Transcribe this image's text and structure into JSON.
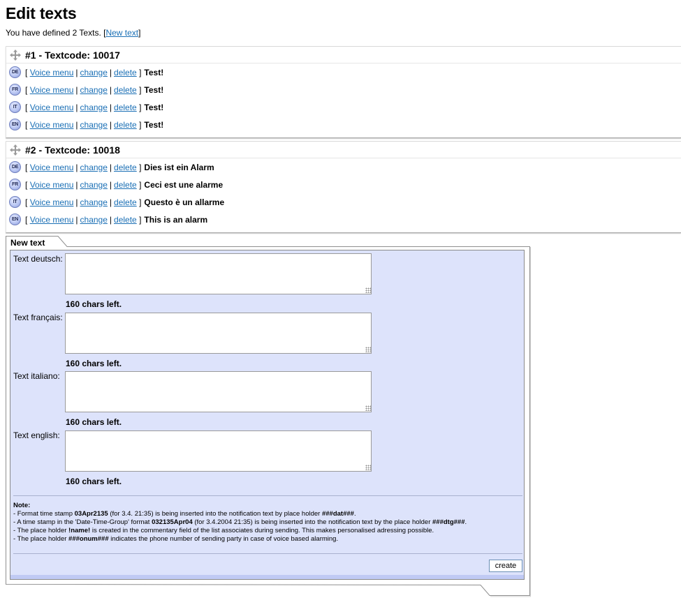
{
  "page": {
    "title": "Edit texts",
    "intro_prefix": "You have defined 2 Texts. [",
    "new_text_link": "New text",
    "intro_suffix": "]"
  },
  "row_links": {
    "open": "[",
    "voice_menu": "Voice menu",
    "pipe": "|",
    "change": "change",
    "delete": "delete",
    "close": "]"
  },
  "texts": [
    {
      "title": "#1 - Textcode: 10017",
      "rows": [
        {
          "lang": "DE",
          "text": "Test!"
        },
        {
          "lang": "FR",
          "text": "Test!"
        },
        {
          "lang": "IT",
          "text": "Test!"
        },
        {
          "lang": "EN",
          "text": "Test!"
        }
      ]
    },
    {
      "title": "#2 - Textcode: 10018",
      "rows": [
        {
          "lang": "DE",
          "text": "Dies ist ein Alarm"
        },
        {
          "lang": "FR",
          "text": "Ceci est une alarme"
        },
        {
          "lang": "IT",
          "text": "Questo è un allarme"
        },
        {
          "lang": "EN",
          "text": "This is an alarm"
        }
      ]
    }
  ],
  "new_text_form": {
    "tab_label": "New text",
    "fields": [
      {
        "label": "Text deutsch:",
        "value": "",
        "chars_left": "160 chars left."
      },
      {
        "label": "Text français:",
        "value": "",
        "chars_left": "160 chars left."
      },
      {
        "label": "Text italiano:",
        "value": "",
        "chars_left": "160 chars left."
      },
      {
        "label": "Text english:",
        "value": "",
        "chars_left": "160 chars left."
      }
    ],
    "note": {
      "heading": "Note:",
      "line1": [
        "- Format time stamp ",
        "03Apr2135",
        " (for 3.4. 21:35) is being inserted into the notification text by place holder ",
        "###dat###",
        "."
      ],
      "line2": [
        "- A time stamp in the 'Date-Time-Group' format ",
        "032135Apr04",
        " (for 3.4.2004 21:35) is being inserted into the notification text by the place holder ",
        "###dtg###",
        "."
      ],
      "line3": [
        "- The place holder ",
        "!name!",
        " is created in the commentary field of the list associates during sending. This makes personalised adressing possible."
      ],
      "line4": [
        "- The place holder ",
        "###onum###",
        " indicates the phone number of sending party in case of voice based alarming."
      ]
    },
    "create_label": "create"
  },
  "colors": {
    "link": "#1a6fb5",
    "panel_bg": "#dde3fb",
    "badge": "#b9c6f2"
  },
  "icons": {
    "move": "move-arrows-icon",
    "language": "language-badge-icon"
  }
}
